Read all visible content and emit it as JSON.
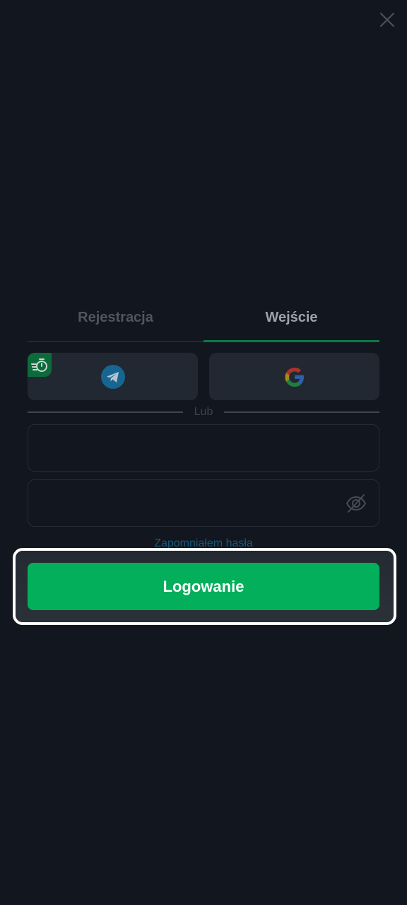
{
  "tabs": [
    {
      "label": "Rejestracja",
      "active": false
    },
    {
      "label": "Wejście",
      "active": true
    }
  ],
  "social": {
    "telegram_icon": "telegram-icon",
    "google_icon": "google-icon",
    "badge_icon": "fast-timer-icon"
  },
  "divider": {
    "label": "Lub"
  },
  "form": {
    "login_value": "",
    "password_value": "",
    "forgot_label": "Zapomniałem hasła"
  },
  "actions": {
    "login_label": "Logowanie"
  },
  "colors": {
    "background": "#12161e",
    "accent": "#03af5a",
    "tab_underline": "#0a7a43",
    "link": "#155a7d"
  }
}
